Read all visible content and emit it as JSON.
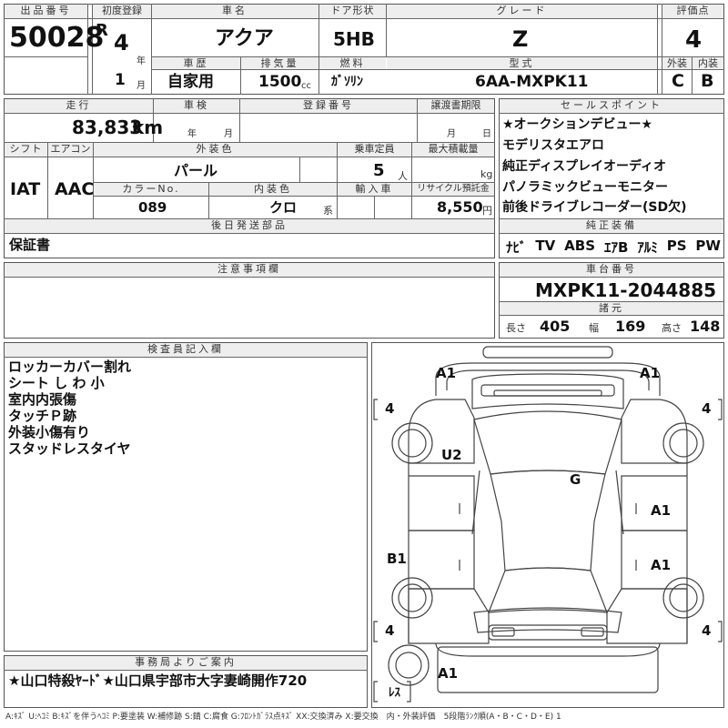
{
  "lot": {
    "label": "出品番号",
    "value": "50028"
  },
  "first_registration": {
    "label": "初度登録",
    "era": "R",
    "year": "4",
    "year_unit": "年",
    "month": "1",
    "month_unit": "月"
  },
  "car_name": {
    "label": "車名",
    "value": "アクア"
  },
  "door_type": {
    "label": "ドア形状",
    "value": "5HB"
  },
  "grade": {
    "label": "グレード",
    "value": "Z"
  },
  "score": {
    "label": "評価点",
    "value": "4"
  },
  "history": {
    "label": "車歴",
    "value": "自家用"
  },
  "displacement": {
    "label": "排気量",
    "value": "1500",
    "unit": "cc"
  },
  "fuel": {
    "label": "燃料",
    "value": "ｶﾞｿﾘﾝ"
  },
  "model_code": {
    "label": "型式",
    "value": "6AA-MXPK11"
  },
  "exterior_grade": {
    "label": "外装",
    "value": "C"
  },
  "interior_grade": {
    "label": "内装",
    "value": "B"
  },
  "mileage": {
    "label": "走行",
    "value": "83,833",
    "unit": "km"
  },
  "inspection": {
    "label": "車検",
    "year_unit": "年",
    "month_unit": "月"
  },
  "registration_number": {
    "label": "登録番号",
    "value": ""
  },
  "transfer_deadline": {
    "label": "譲渡書期限",
    "month_unit": "月",
    "day_unit": "日"
  },
  "shift": {
    "label": "シフト",
    "value": "IAT"
  },
  "aircon": {
    "label": "エアコン",
    "value": "AAC"
  },
  "exterior_color": {
    "label": "外装色",
    "value": "パール"
  },
  "capacity": {
    "label": "乗車定員",
    "value": "5",
    "unit": "人"
  },
  "max_load": {
    "label": "最大積載量",
    "unit": "kg"
  },
  "color_no": {
    "label": "カラーNo.",
    "value": "089"
  },
  "interior_color": {
    "label": "内装色",
    "value": "クロ",
    "suffix": "系"
  },
  "import": {
    "label": "輸入車"
  },
  "recycle": {
    "label": "リサイクル預託金",
    "value": "8,550",
    "unit": "円"
  },
  "later_parts": {
    "label": "後日発送部品",
    "value": "保証書"
  },
  "notes": {
    "label": "注意事項欄"
  },
  "sales_points": {
    "label": "セールスポイント",
    "items": [
      "★オークションデビュー★",
      "モデリスタエアロ",
      "純正ディスプレイオーディオ",
      "パノラミックビューモニター",
      "前後ドライブレコーダー(SD欠)"
    ]
  },
  "equipment": {
    "label": "純正装備",
    "items": [
      "ﾅﾋﾞ",
      "TV",
      "ABS",
      "ｴｱB",
      "ｱﾙﾐ",
      "PS",
      "PW"
    ]
  },
  "chassis": {
    "label": "車台番号",
    "value": "MXPK11-2044885"
  },
  "specs": {
    "label": "諸元",
    "length_label": "長さ",
    "length": "405",
    "width_label": "幅",
    "width": "169",
    "height_label": "高さ",
    "height": "148"
  },
  "inspector": {
    "label": "検査員記入欄",
    "lines": [
      "ロッカーカバー割れ",
      "シート し わ 小",
      "室内内張傷",
      "タッチＰ跡",
      "外装小傷有り",
      "スタッドレスタイヤ"
    ]
  },
  "office": {
    "label": "事務局よりご案内",
    "value": "★山口特殺ﾔｰﾄﾞ★山口県宇部市大字妻崎開作720"
  },
  "diagram": {
    "marks": {
      "front_left": "A1",
      "front_right": "A1",
      "tire_front_left": "4",
      "tire_front_right": "4",
      "left_front_door": "U2",
      "roof": "G",
      "right_front_door": "A1",
      "left_rear_door": "B1",
      "right_rear_door": "A1",
      "tire_rear_left": "4",
      "tire_rear_right": "4",
      "rear": "A1",
      "spare": "ﾚｽ"
    }
  },
  "legend": "A:ｷｽﾞ U:ﾍｺﾐ B:ｷｽﾞを伴うﾍｺﾐ P:要塗装 W:補修跡 S:錆 C:腐食 G:ﾌﾛﾝﾄｶﾞﾗｽ点ｷｽﾞ XX:交換済み X:要交換　内・外装評価　5段階ﾗﾝｸ順(A・B・C・D・E) 1"
}
